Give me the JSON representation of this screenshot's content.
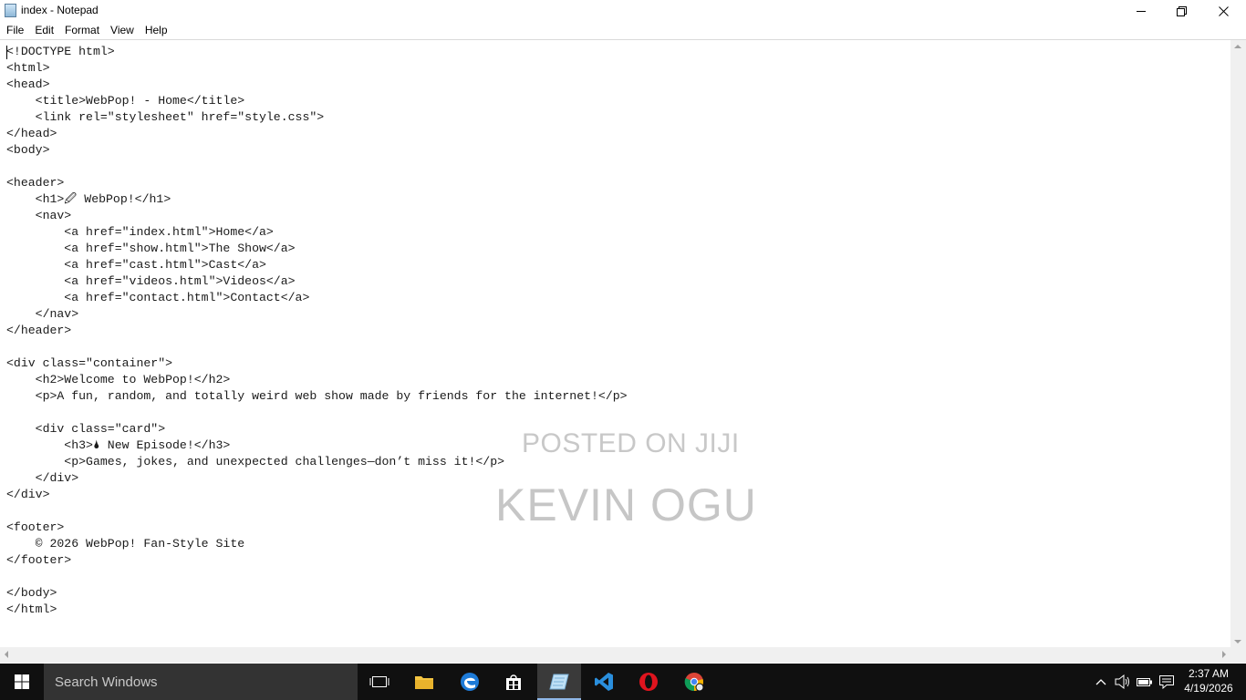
{
  "window": {
    "title": "index - Notepad",
    "icon": "notepad-icon",
    "controls": [
      "minimize-icon",
      "restore-icon",
      "close-icon"
    ]
  },
  "menu": {
    "items": [
      "File",
      "Edit",
      "Format",
      "View",
      "Help"
    ]
  },
  "editor": {
    "content": "<!DOCTYPE html>\n<html>\n<head>\n    <title>WebPop! - Home</title>\n    <link rel=\"stylesheet\" href=\"style.css\">\n</head>\n<body>\n\n<header>\n    <h1>🖉 WebPop!</h1>\n    <nav>\n        <a href=\"index.html\">Home</a>\n        <a href=\"show.html\">The Show</a>\n        <a href=\"cast.html\">Cast</a>\n        <a href=\"videos.html\">Videos</a>\n        <a href=\"contact.html\">Contact</a>\n    </nav>\n</header>\n\n<div class=\"container\">\n    <h2>Welcome to WebPop!</h2>\n    <p>A fun, random, and totally weird web show made by friends for the internet!</p>\n\n    <div class=\"card\">\n        <h3>🌢 New Episode!</h3>\n        <p>Games, jokes, and unexpected challenges—don’t miss it!</p>\n    </div>\n</div>\n\n<footer>\n    © 2026 WebPop! Fan-Style Site\n</footer>\n\n</body>\n</html>"
  },
  "watermark": {
    "line1": "POSTED ON JIJI",
    "line2": "KEVIN OGU"
  },
  "taskbar": {
    "search_placeholder": "Search Windows",
    "pinned_icons": [
      "task-view-icon",
      "file-explorer-icon",
      "edge-icon",
      "store-icon",
      "notepad-icon",
      "vscode-icon",
      "opera-icon",
      "chrome-icon"
    ],
    "active_app": "notepad-icon",
    "tray_icons": [
      "chevron-up-icon",
      "volume-icon",
      "battery-icon",
      "notification-icon"
    ],
    "time": "2:37 AM",
    "date": "4/19/2026"
  }
}
